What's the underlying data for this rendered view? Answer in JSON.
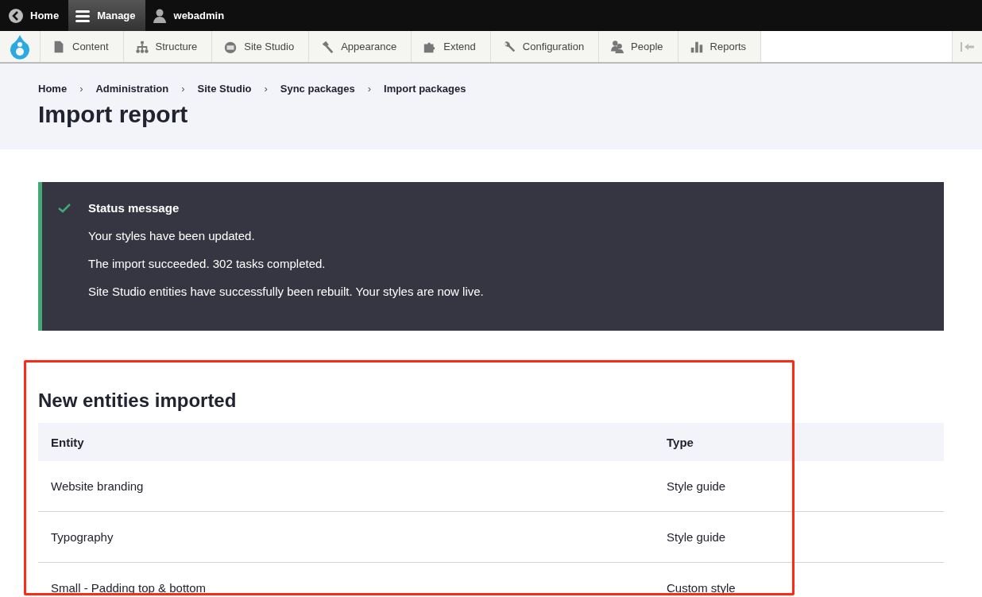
{
  "toolbar": {
    "items": [
      {
        "label": "Home",
        "selected": false
      },
      {
        "label": "Manage",
        "selected": true
      },
      {
        "label": "webadmin",
        "selected": false
      }
    ]
  },
  "admin_menu": {
    "items": [
      {
        "label": "Content"
      },
      {
        "label": "Structure"
      },
      {
        "label": "Site Studio"
      },
      {
        "label": "Appearance"
      },
      {
        "label": "Extend"
      },
      {
        "label": "Configuration"
      },
      {
        "label": "People"
      },
      {
        "label": "Reports"
      }
    ]
  },
  "breadcrumb": [
    "Home",
    "Administration",
    "Site Studio",
    "Sync packages",
    "Import packages"
  ],
  "breadcrumb_separator": "›",
  "page_title": "Import report",
  "status": {
    "title": "Status message",
    "messages": [
      "Your styles have been updated.",
      "The import succeeded. 302 tasks completed.",
      "Site Studio entities have successfully been rebuilt. Your styles are now live."
    ]
  },
  "section_title": "New entities imported",
  "table": {
    "columns": [
      "Entity",
      "Type"
    ],
    "rows": [
      [
        "Website branding",
        "Style guide"
      ],
      [
        "Typography",
        "Style guide"
      ],
      [
        "Small - Padding top & bottom",
        "Custom style"
      ]
    ]
  }
}
